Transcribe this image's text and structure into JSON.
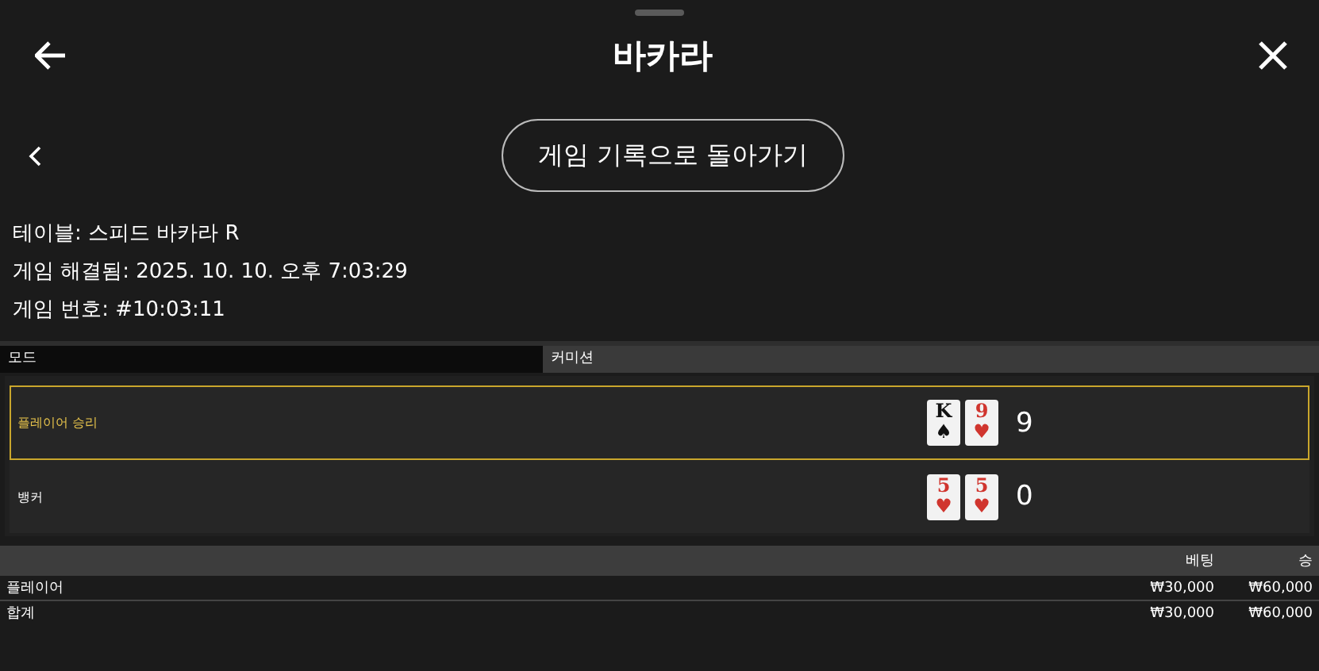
{
  "header": {
    "title": "바카라"
  },
  "back_to_history": {
    "label": "게임 기록으로 돌아가기"
  },
  "info": [
    "테이블: 스피드 바카라 R",
    "게임 해결됨: 2025. 10. 10. 오후 7:03:29",
    "게임 번호: #10:03:11"
  ],
  "mode_bar": [
    {
      "label": "모드",
      "selected": true
    },
    {
      "label": "커미션",
      "selected": false
    }
  ],
  "hands": [
    {
      "label": "플레이어 승리",
      "winner": true,
      "score": "9",
      "cards": [
        {
          "rank": "K",
          "suit": "♠"
        },
        {
          "rank": "9",
          "suit": "♥"
        }
      ]
    },
    {
      "label": "뱅커",
      "winner": false,
      "score": "0",
      "cards": [
        {
          "rank": "5",
          "suit": "♥"
        },
        {
          "rank": "5",
          "suit": "♥"
        }
      ]
    }
  ],
  "bets": {
    "columns": [
      "베팅",
      "승"
    ],
    "rows": [
      {
        "label": "플레이어",
        "cells": [
          "₩30,000",
          "₩60,000"
        ]
      },
      {
        "label": "합계",
        "cells": [
          "₩30,000",
          "₩60,000"
        ]
      }
    ]
  }
}
